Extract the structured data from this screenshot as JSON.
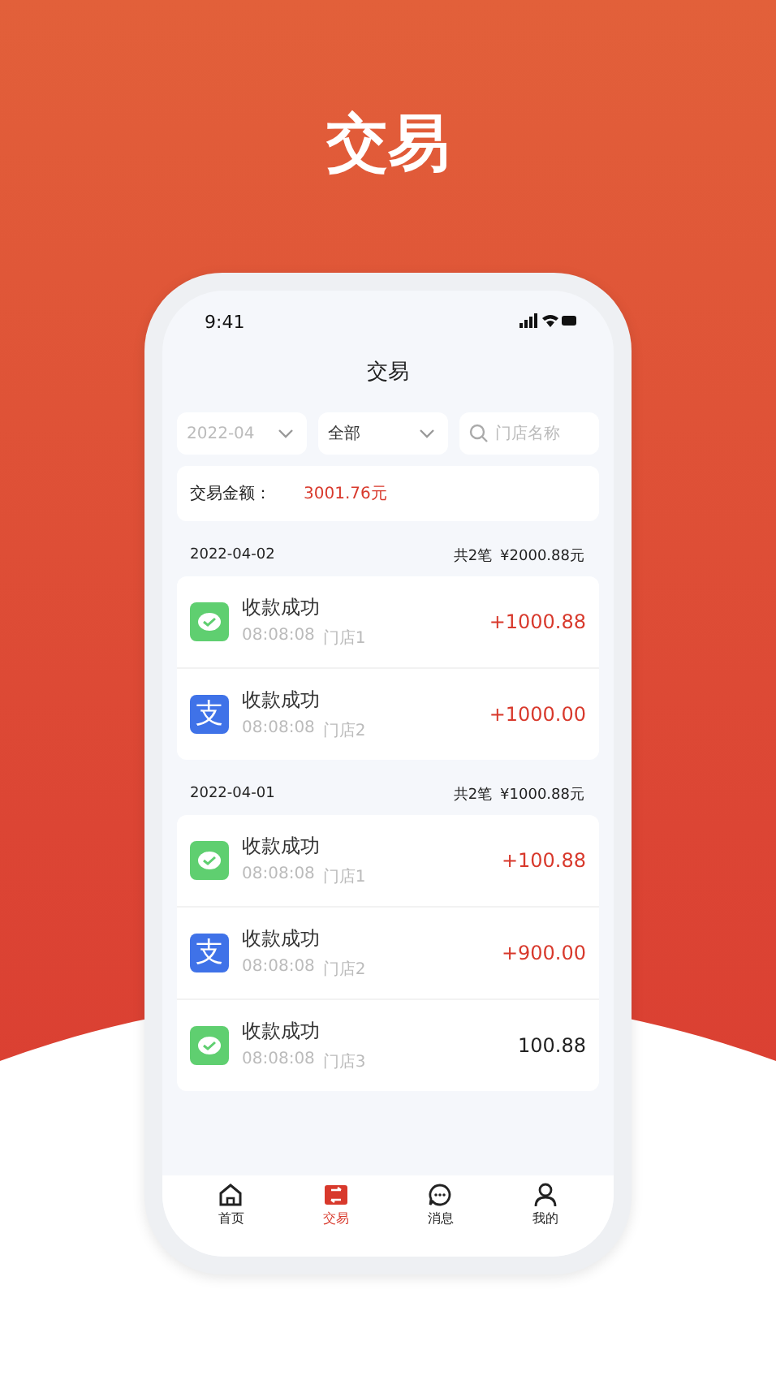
{
  "headline": "交易",
  "status_bar": {
    "time": "9:41"
  },
  "nav_title": "交易",
  "filters": {
    "month": "2022-04",
    "type": "全部",
    "search_placeholder": "门店名称"
  },
  "summary": {
    "label": "交易金额：",
    "amount": "3001.76元"
  },
  "groups": [
    {
      "date": "2022-04-02",
      "count": "共2笔",
      "total": "¥2000.88元",
      "items": [
        {
          "kind": "wechat",
          "title": "收款成功",
          "time": "08:08:08",
          "store": "门店1",
          "amount": "+1000.88",
          "income": true
        },
        {
          "kind": "alipay",
          "icon_char": "支",
          "title": "收款成功",
          "time": "08:08:08",
          "store": "门店2",
          "amount": "+1000.00",
          "income": true
        }
      ]
    },
    {
      "date": "2022-04-01",
      "count": "共2笔",
      "total": "¥1000.88元",
      "items": [
        {
          "kind": "wechat",
          "title": "收款成功",
          "time": "08:08:08",
          "store": "门店1",
          "amount": "+100.88",
          "income": true
        },
        {
          "kind": "alipay",
          "icon_char": "支",
          "title": "收款成功",
          "time": "08:08:08",
          "store": "门店2",
          "amount": "+900.00",
          "income": true
        },
        {
          "kind": "wechat",
          "title": "收款成功",
          "time": "08:08:08",
          "store": "门店3",
          "amount": "100.88",
          "income": false
        }
      ]
    }
  ],
  "tabs": [
    {
      "kind": "home",
      "label": "首页",
      "selected": false
    },
    {
      "kind": "trade",
      "label": "交易",
      "selected": true
    },
    {
      "kind": "message",
      "label": "消息",
      "selected": false
    },
    {
      "kind": "mine",
      "label": "我的",
      "selected": false
    }
  ]
}
